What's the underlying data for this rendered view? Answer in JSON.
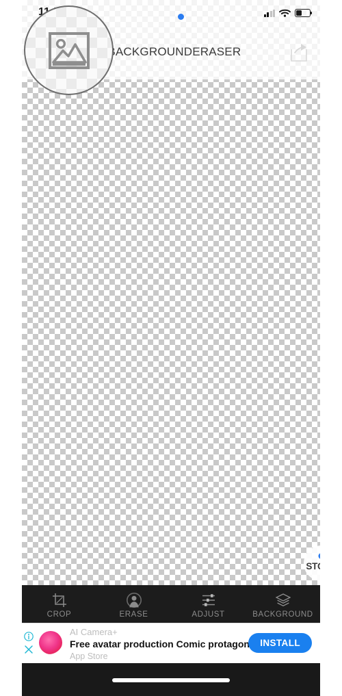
{
  "app": {
    "title": "#BACKGROUNDERASER"
  },
  "status_bar": {
    "time": "11:56",
    "signal_icon": "cellular-signal-icon",
    "signal_bars_filled": 2,
    "signal_bars_total": 4,
    "wifi_icon": "wifi-icon",
    "battery_icon": "battery-icon",
    "battery_percent": 42,
    "recording_dot_icon": "blue-status-dot-icon",
    "accent_blue": "#2b7cf0"
  },
  "header": {
    "share_icon": "share-export-icon",
    "magnifier": {
      "icon": "image-placeholder-icon",
      "name": "magnifier-loupe"
    }
  },
  "canvas": {
    "transparency_pattern": "checkerboard",
    "checker_light": "#ffffff",
    "checker_dark": "#c9c9c9"
  },
  "store_button": {
    "label": "STORE",
    "badge_icon": "blue-dot-badge-icon",
    "badge_color": "#2b7cf0"
  },
  "toolbar": {
    "background": "#1c1c1c",
    "items": [
      {
        "label": "CROP",
        "icon": "crop-icon"
      },
      {
        "label": "ERASE",
        "icon": "person-portrait-icon"
      },
      {
        "label": "ADJUST",
        "icon": "sliders-icon"
      },
      {
        "label": "BACKGROUND",
        "icon": "layers-icon"
      }
    ]
  },
  "ad": {
    "app_name": "AI Camera+",
    "headline": "Free avatar production Comic protagonist",
    "source": "App Store",
    "install_label": "INSTALL",
    "install_color": "#1a80ef",
    "info_icon": "info-circle-icon",
    "close_icon": "close-x-icon",
    "control_color": "#20b8d4",
    "app_icon": "camera-lens-icon"
  },
  "home_bar": {
    "indicator_icon": "home-indicator-bar"
  }
}
